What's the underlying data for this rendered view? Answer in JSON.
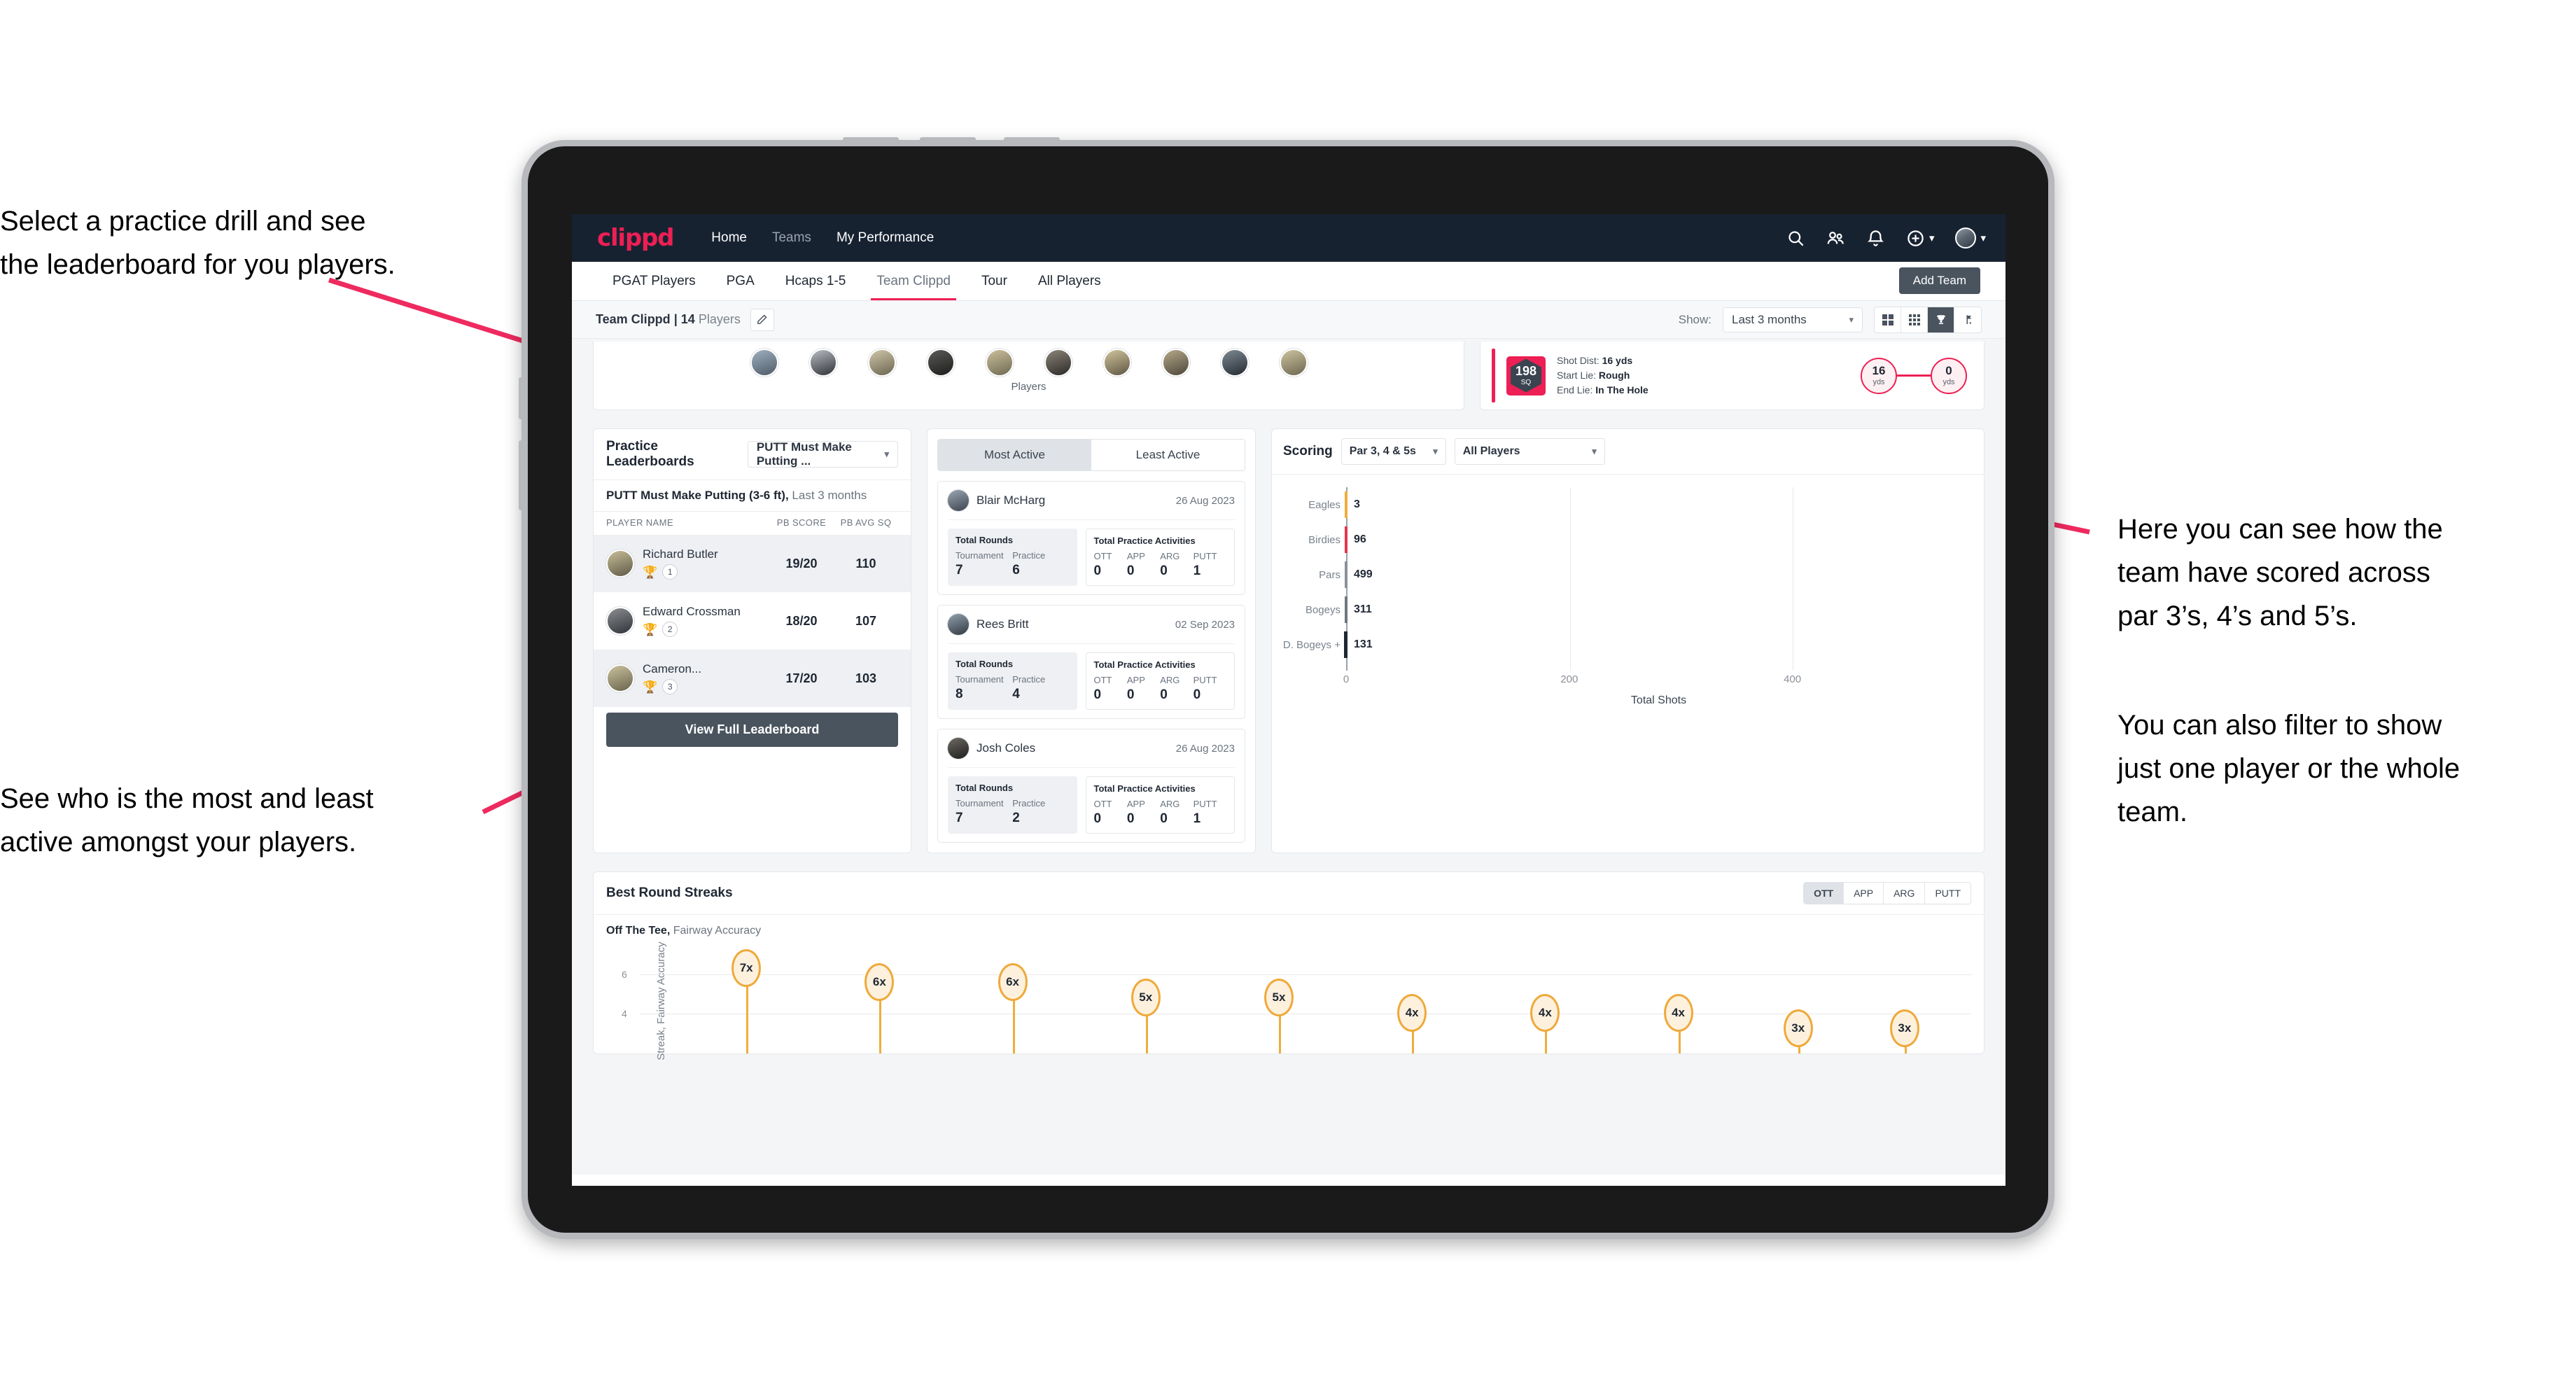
{
  "annotations": {
    "top_left": "Select a practice drill and see\nthe leaderboard for you players.",
    "bottom_left": "See who is the most and least\nactive amongst your players.",
    "right_1": "Here you can see how the\nteam have scored across\npar 3’s, 4’s and 5’s.",
    "right_2": "You can also filter to show\njust one player or the whole\nteam."
  },
  "colors": {
    "brand_pink": "#ed1f54",
    "header_navy": "#172231",
    "dark_button": "#4a545f",
    "streak_amber": "#efa93a",
    "eagles_bar": "#f0ad3c",
    "birdies_bar": "#e8334a",
    "pars_bar": "#8b9099",
    "bogeys_bar": "#6f767e",
    "dbogeys_bar": "#1f2733"
  },
  "header": {
    "logo": "clippd",
    "nav": [
      {
        "label": "Home",
        "active": true
      },
      {
        "label": "Teams",
        "active": false
      },
      {
        "label": "My Performance",
        "active": true
      }
    ],
    "icons": [
      "search-icon",
      "people-icon",
      "bell-icon",
      "plus-circle-icon",
      "avatar"
    ]
  },
  "tabs": {
    "items": [
      {
        "label": "PGAT Players",
        "active": false
      },
      {
        "label": "PGA",
        "active": false
      },
      {
        "label": "Hcaps 1-5",
        "active": false
      },
      {
        "label": "Team Clippd",
        "active": true
      },
      {
        "label": "Tour",
        "active": false
      },
      {
        "label": "All Players",
        "active": false
      }
    ],
    "add_team_label": "Add Team"
  },
  "subbar": {
    "team_name": "Team Clippd",
    "separator": "|",
    "player_count": "14",
    "players_word": "Players",
    "edit_icon": "pencil-icon",
    "show_label": "Show:",
    "range_value": "Last 3 months",
    "view_icons": [
      "grid-large-icon",
      "grid-small-icon",
      "trophy-icon",
      "flag-icon"
    ],
    "active_view": "trophy-icon"
  },
  "players_strip": {
    "label": "Players",
    "avatar_count": 10
  },
  "shot_card": {
    "badge_number": "198",
    "badge_unit": "SQ",
    "rows": [
      {
        "label": "Shot Dist:",
        "value": "16 yds"
      },
      {
        "label": "Start Lie:",
        "value": "Rough"
      },
      {
        "label": "End Lie:",
        "value": "In The Hole"
      }
    ],
    "start_yds": "16",
    "end_yds": "0",
    "yds_unit": "yds"
  },
  "leaderboard": {
    "title": "Practice Leaderboards",
    "drill_select": "PUTT Must Make Putting ...",
    "subtitle_bold": "PUTT Must Make Putting (3-6 ft),",
    "subtitle_muted": "Last 3 months",
    "columns": [
      "PLAYER NAME",
      "PB SCORE",
      "PB AVG SQ"
    ],
    "rows": [
      {
        "name": "Richard Butler",
        "rank": "1",
        "trophy": "gold",
        "pb_score": "19/20",
        "pb_avg_sq": "110"
      },
      {
        "name": "Edward Crossman",
        "rank": "2",
        "trophy": "silver",
        "pb_score": "18/20",
        "pb_avg_sq": "107"
      },
      {
        "name": "Cameron...",
        "rank": "3",
        "trophy": "bronze",
        "pb_score": "17/20",
        "pb_avg_sq": "103"
      }
    ],
    "button_label": "View Full Leaderboard"
  },
  "activity": {
    "tabs": [
      {
        "label": "Most Active",
        "active": true
      },
      {
        "label": "Least Active",
        "active": false
      }
    ],
    "rounds_title": "Total Rounds",
    "rounds_keys": [
      "Tournament",
      "Practice"
    ],
    "practice_title": "Total Practice Activities",
    "practice_keys": [
      "OTT",
      "APP",
      "ARG",
      "PUTT"
    ],
    "players": [
      {
        "name": "Blair McHarg",
        "date": "26 Aug 2023",
        "tournament": "7",
        "practice": "6",
        "ott": "0",
        "app": "0",
        "arg": "0",
        "putt": "1"
      },
      {
        "name": "Rees Britt",
        "date": "02 Sep 2023",
        "tournament": "8",
        "practice": "4",
        "ott": "0",
        "app": "0",
        "arg": "0",
        "putt": "0"
      },
      {
        "name": "Josh Coles",
        "date": "26 Aug 2023",
        "tournament": "7",
        "practice": "2",
        "ott": "0",
        "app": "0",
        "arg": "0",
        "putt": "1"
      }
    ]
  },
  "scoring": {
    "title": "Scoring",
    "par_select": "Par 3, 4 & 5s",
    "player_select": "All Players"
  },
  "streaks": {
    "title": "Best Round Streaks",
    "toggle": [
      {
        "label": "OTT",
        "active": true
      },
      {
        "label": "APP",
        "active": false
      },
      {
        "label": "ARG",
        "active": false
      },
      {
        "label": "PUTT",
        "active": false
      }
    ],
    "sub_bold": "Off The Tee,",
    "sub_muted": "Fairway Accuracy"
  },
  "chart_data": [
    {
      "type": "bar",
      "orientation": "horizontal",
      "title": "Scoring",
      "categories": [
        "Eagles",
        "Birdies",
        "Pars",
        "Bogeys",
        "D. Bogeys +"
      ],
      "values": [
        3,
        96,
        499,
        311,
        131
      ],
      "bar_colors": [
        "#f0ad3c",
        "#e8334a",
        "#8b9099",
        "#6f767e",
        "#1f2733"
      ],
      "xlabel": "Total Shots",
      "ylabel": "",
      "xlim": [
        0,
        560
      ],
      "xticks": [
        0,
        200,
        400
      ],
      "grid": true,
      "data_labels": [
        "3",
        "96",
        "499",
        "311",
        "131"
      ]
    },
    {
      "type": "scatter",
      "title": "Best Round Streaks",
      "subtitle": "Off The Tee, Fairway Accuracy",
      "ylabel": "Streak, Fairway Accuracy",
      "yticks": [
        4,
        6
      ],
      "ylim": [
        0,
        8
      ],
      "values": [
        7,
        6,
        6,
        5,
        5,
        4,
        4,
        4,
        3,
        3
      ],
      "labels": [
        "7x",
        "6x",
        "6x",
        "5x",
        "5x",
        "4x",
        "4x",
        "4x",
        "3x",
        "3x"
      ],
      "marker": "lollipop",
      "color": "#efa93a",
      "grid": true
    }
  ]
}
